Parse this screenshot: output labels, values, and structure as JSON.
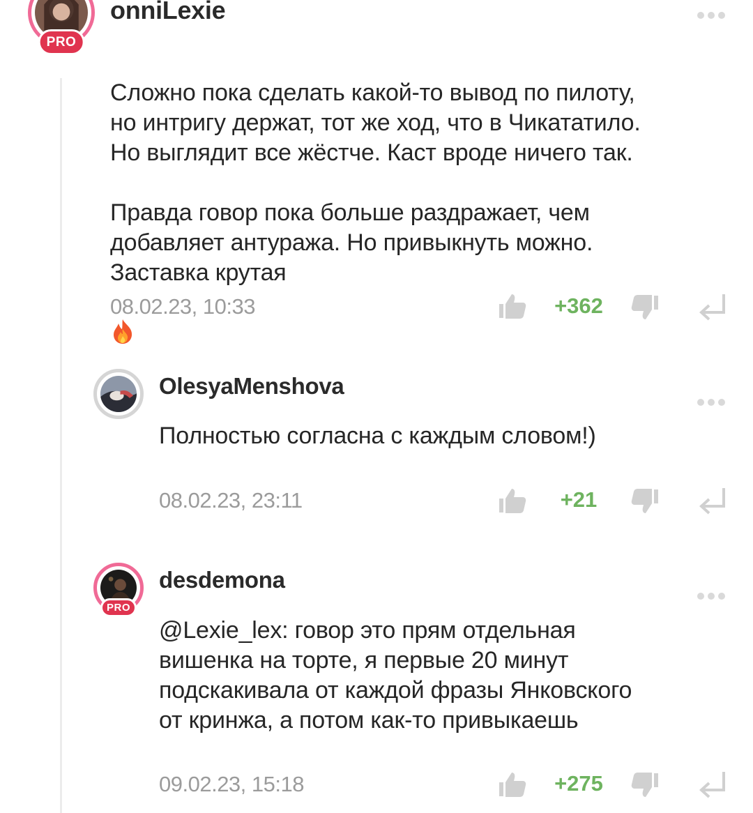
{
  "comments": [
    {
      "username": "onniLexie",
      "pro_label": "PRO",
      "text": "Сложно пока сделать какой-то вывод по пилоту,\nно интригу держат, тот же ход, что в Чикататило.\nНо выглядит все жёстче. Каст вроде ничего так.\n\nПравда говор пока больше раздражает, чем\nдобавляет антуража. Но привыкнуть можно.\nЗаставка крутая",
      "emoji": "fire-emoji",
      "timestamp": "08.02.23, 10:33",
      "rating": "+362"
    },
    {
      "username": "OlesyaMenshova",
      "text": "Полностью согласна с каждым словом!)",
      "timestamp": "08.02.23, 23:11",
      "rating": "+21"
    },
    {
      "username": "desdemona",
      "pro_label": "PRO",
      "text": "@Lexie_lex: говор это прям отдельная\nвишенка на торте, я первые 20 минут\nподскакивала от каждой фразы Янковского\nот кринжа, а потом как-то привыкаешь",
      "timestamp": "09.02.23, 15:18",
      "rating": "+275"
    }
  ],
  "colors": {
    "rating_positive": "#6eb35f",
    "pro_ring": "#f06a96",
    "pro_badge": "#e0344f",
    "meta_gray": "#9b9b9b",
    "icon_gray": "#d0d0d0"
  },
  "icons": [
    "thumbs-up-icon",
    "thumbs-down-icon",
    "reply-arrow-icon",
    "more-dots-icon",
    "fire-emoji"
  ]
}
